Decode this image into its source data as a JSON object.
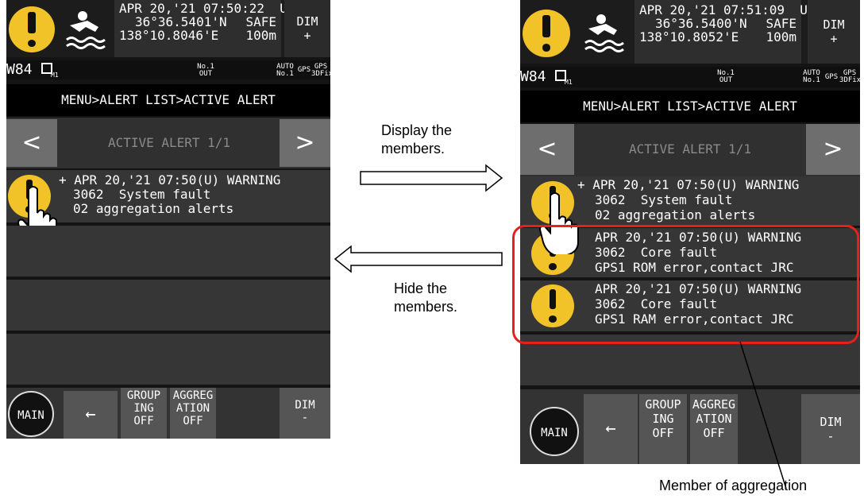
{
  "left_screen": {
    "status": {
      "line1": "APR 20,'21 07:50:22  U",
      "line2": "36°36.5401'N",
      "line2b": "SAFE",
      "line3": "138°10.8046'E",
      "line3b": "100m"
    },
    "dim_top": {
      "label": "DIM",
      "sign": "+"
    },
    "statusbar": {
      "id": "W84",
      "sub": "M1",
      "no1_out_a": "No.1",
      "no1_out_b": "OUT",
      "auto_a": "AUTO",
      "auto_b": "No.1",
      "gps": "GPS",
      "gps3d_a": "GPS",
      "gps3d_b": "3DFix"
    },
    "breadcrumb": "MENU>ALERT LIST>ACTIVE ALERT",
    "nav": {
      "prev": "<",
      "title": "ACTIVE ALERT 1/1",
      "next": ">"
    },
    "alert": {
      "line1": "+ APR 20,'21 07:50(U) WARNING",
      "line2": "3062  System fault",
      "line3": "02 aggregation alerts"
    },
    "bottom": {
      "main": "MAIN",
      "back": "←",
      "grouping": [
        "GROUP",
        "ING",
        "OFF"
      ],
      "aggregation": [
        "AGGREG",
        "ATION",
        "OFF"
      ],
      "dim": "DIM",
      "dim_sign": "-"
    }
  },
  "right_screen": {
    "status": {
      "line1": "APR 20,'21 07:51:09  U",
      "line2": "36°36.5400'N",
      "line2b": "SAFE",
      "line3": "138°10.8052'E",
      "line3b": "100m"
    },
    "dim_top": {
      "label": "DIM",
      "sign": "+"
    },
    "statusbar": {
      "id": "W84",
      "sub": "M1",
      "no1_out_a": "No.1",
      "no1_out_b": "OUT",
      "auto_a": "AUTO",
      "auto_b": "No.1",
      "gps": "GPS",
      "gps3d_a": "GPS",
      "gps3d_b": "3DFix"
    },
    "breadcrumb": "MENU>ALERT LIST>ACTIVE ALERT",
    "nav": {
      "prev": "<",
      "title": "ACTIVE ALERT 1/1",
      "next": ">"
    },
    "alert": {
      "line1": "+ APR 20,'21 07:50(U) WARNING",
      "line2": "3062  System fault",
      "line3": "02 aggregation alerts"
    },
    "member1": {
      "line1": "APR 20,'21 07:50(U) WARNING",
      "line2": "3062  Core fault",
      "line3": "GPS1 ROM error,contact JRC"
    },
    "member2": {
      "line1": "APR 20,'21 07:50(U) WARNING",
      "line2": "3062  Core fault",
      "line3": "GPS1 RAM error,contact JRC"
    },
    "bottom": {
      "main": "MAIN",
      "back": "←",
      "grouping": [
        "GROUP",
        "ING",
        "OFF"
      ],
      "aggregation": [
        "AGGREG",
        "ATION",
        "OFF"
      ],
      "dim": "DIM",
      "dim_sign": "-"
    }
  },
  "annotations": {
    "display": [
      "Display the",
      "members."
    ],
    "hide": [
      "Hide the",
      "members."
    ],
    "member_of_aggregation": "Member of aggregation"
  },
  "colors": {
    "warning_yellow": "#f2c329",
    "highlight_red": "#e8201a",
    "screen_bg": "#141414"
  }
}
